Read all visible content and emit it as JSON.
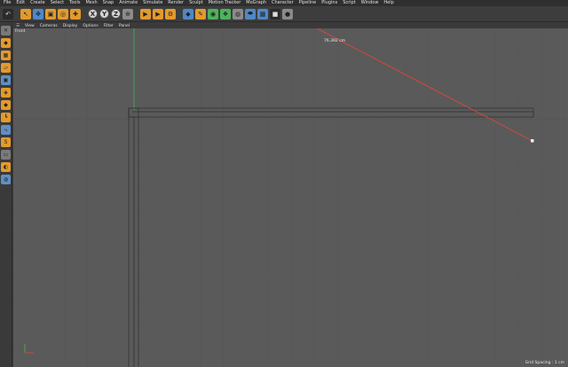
{
  "menu": [
    "File",
    "Edit",
    "Create",
    "Select",
    "Tools",
    "Mesh",
    "Snap",
    "Animate",
    "Simulate",
    "Render",
    "Sculpt",
    "Motion Tracker",
    "MoGraph",
    "Character",
    "Pipeline",
    "Plugins",
    "Script",
    "Window",
    "Help"
  ],
  "toolbar": {
    "axis_x": "X",
    "axis_y": "Y",
    "axis_z": "Z"
  },
  "viewport": {
    "menu": [
      "View",
      "Cameras",
      "Display",
      "Options",
      "Filter",
      "Panel"
    ],
    "label": "Front",
    "grid_spacing": "Grid Spacing : 1 cm",
    "measurement": "76.392 cm"
  },
  "colors": {
    "measure_line": "#e0453a",
    "y_axis": "#4db25a",
    "viewport_bg": "#5a5a5a"
  }
}
